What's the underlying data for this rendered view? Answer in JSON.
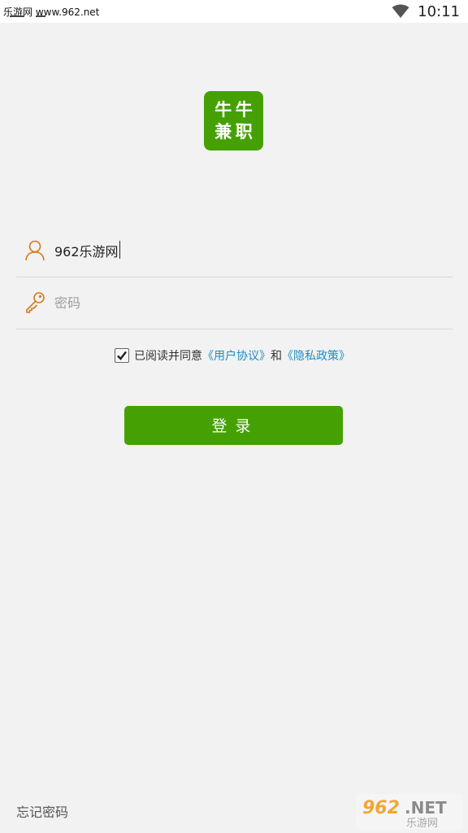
{
  "status_bar": {
    "carrier_text": "乐游网 www.962.net",
    "time": "10:11",
    "wifi_icon": "wifi-icon"
  },
  "logo": {
    "chars": [
      "牛",
      "牛",
      "兼",
      "职"
    ],
    "color": "#45a103"
  },
  "login_form": {
    "username": {
      "value": "962乐游网",
      "placeholder": "",
      "icon": "user-icon"
    },
    "password": {
      "value": "",
      "placeholder": "密码",
      "icon": "key-icon"
    }
  },
  "agreement": {
    "checked": true,
    "prefix": "已阅读并同意",
    "user_agreement": "《用户协议》",
    "conjunction": "和",
    "privacy_policy": "《隐私政策》",
    "link_color": "#1a8fc4"
  },
  "login_button": {
    "label": "登录",
    "color": "#45a103"
  },
  "forgot_password": "忘记密码",
  "watermark": {
    "brand": "962.NET",
    "sub": "乐游网"
  }
}
